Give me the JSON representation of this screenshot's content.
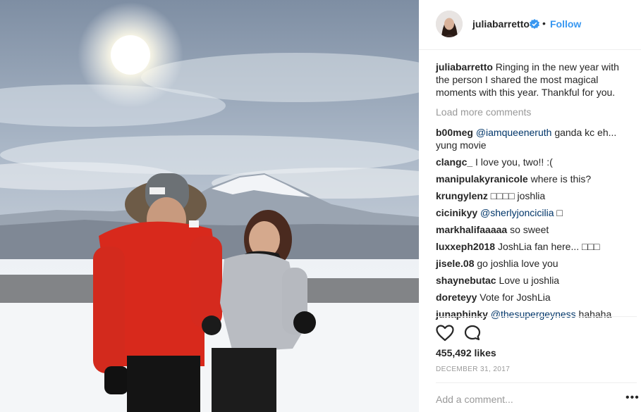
{
  "post": {
    "username": "juliabarretto",
    "follow_label": "Follow",
    "separator": "•",
    "caption": "Ringing in the new year with the person I shared the most magical moments with this year. Thankful for you.",
    "load_more": "Load more comments",
    "comments": [
      {
        "user": "b00meg",
        "mention": "@iamqueeneruth",
        "text": " ganda kc eh... yung movie"
      },
      {
        "user": "clangc_",
        "mention": "",
        "text": "I love you, two!! :("
      },
      {
        "user": "manipulakyranicole",
        "mention": "",
        "text": "where is this?"
      },
      {
        "user": "krungylenz",
        "mention": "",
        "text": "□□□□ joshlia"
      },
      {
        "user": "cicinikyy",
        "mention": "@sherlyjoncicilia",
        "text": " □"
      },
      {
        "user": "markhalifaaaaa",
        "mention": "",
        "text": "so sweet"
      },
      {
        "user": "luxxeph2018",
        "mention": "",
        "text": "JoshLia fan here... □□□"
      },
      {
        "user": "jisele.08",
        "mention": "",
        "text": "go joshlia love you"
      },
      {
        "user": "shaynebutac",
        "mention": "",
        "text": "Love u joshlia"
      },
      {
        "user": "doreteyy",
        "mention": "",
        "text": "Vote for JoshLia"
      },
      {
        "user": "junaphinky",
        "mention": "@thesupergeyness",
        "text": " hahaha"
      }
    ],
    "likes_count": "455,492",
    "likes_word": "likes",
    "date": "DECEMBER 31, 2017",
    "add_comment_placeholder": "Add a comment...",
    "more_options": "•••"
  },
  "colors": {
    "accent": "#3897f0",
    "verified": "#3897f0",
    "muted": "#999999"
  },
  "icons": [
    "verified-badge-icon",
    "heart-icon",
    "comment-icon",
    "more-options-icon"
  ]
}
